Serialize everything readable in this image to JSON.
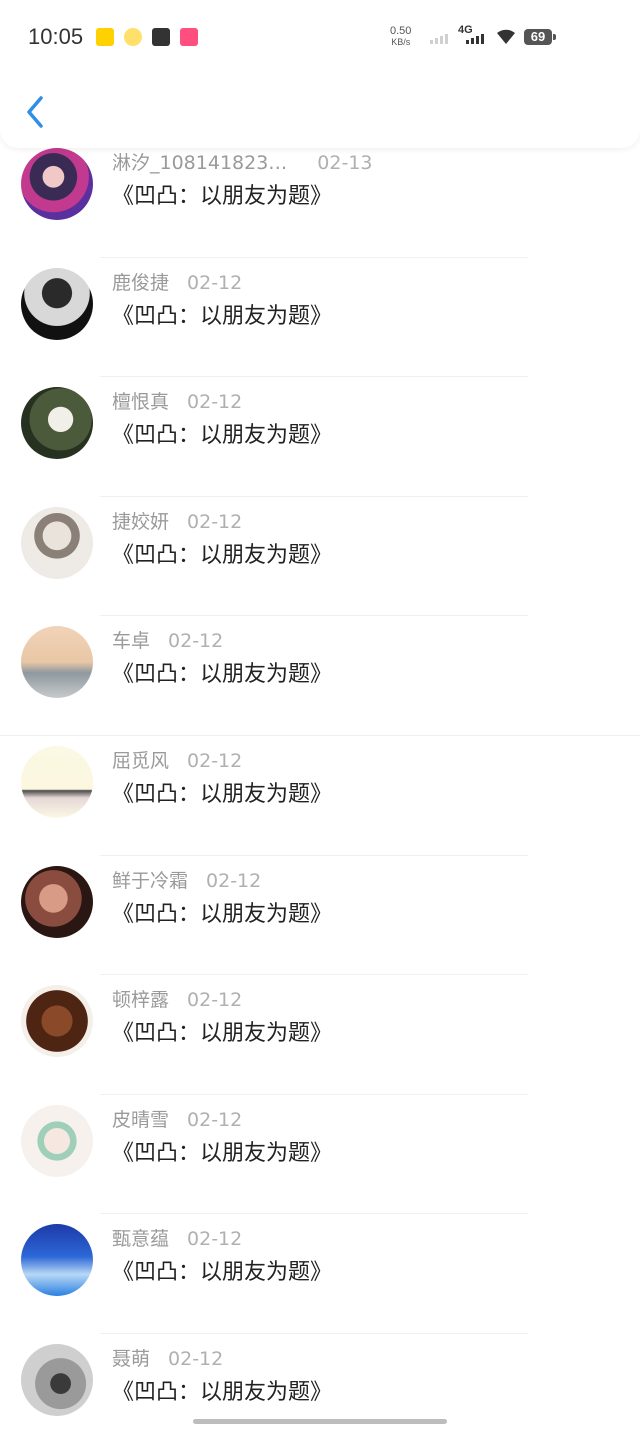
{
  "status_bar": {
    "time": "10:05",
    "net_speed_value": "0.50",
    "net_speed_unit": "KB/s",
    "network": "4G",
    "battery": "69"
  },
  "header": {
    "back_icon": "chevron-left-icon"
  },
  "items": [
    {
      "name": "淋汐_108141823…",
      "date": "02-13",
      "title": "《凹凸：以朋友为题》"
    },
    {
      "name": "鹿俊捷",
      "date": "02-12",
      "title": "《凹凸：以朋友为题》"
    },
    {
      "name": "檀恨真",
      "date": "02-12",
      "title": "《凹凸：以朋友为题》"
    },
    {
      "name": "捷姣妍",
      "date": "02-12",
      "title": "《凹凸：以朋友为题》"
    },
    {
      "name": "车卓",
      "date": "02-12",
      "title": "《凹凸：以朋友为题》"
    },
    {
      "name": "屈觅风",
      "date": "02-12",
      "title": "《凹凸：以朋友为题》"
    },
    {
      "name": "鲜于冷霜",
      "date": "02-12",
      "title": "《凹凸：以朋友为题》"
    },
    {
      "name": "顿梓露",
      "date": "02-12",
      "title": "《凹凸：以朋友为题》"
    },
    {
      "name": "皮晴雪",
      "date": "02-12",
      "title": "《凹凸：以朋友为题》"
    },
    {
      "name": "甄意蕴",
      "date": "02-12",
      "title": "《凹凸：以朋友为题》"
    },
    {
      "name": "聂萌",
      "date": "02-12",
      "title": "《凹凸：以朋友为题》"
    }
  ]
}
